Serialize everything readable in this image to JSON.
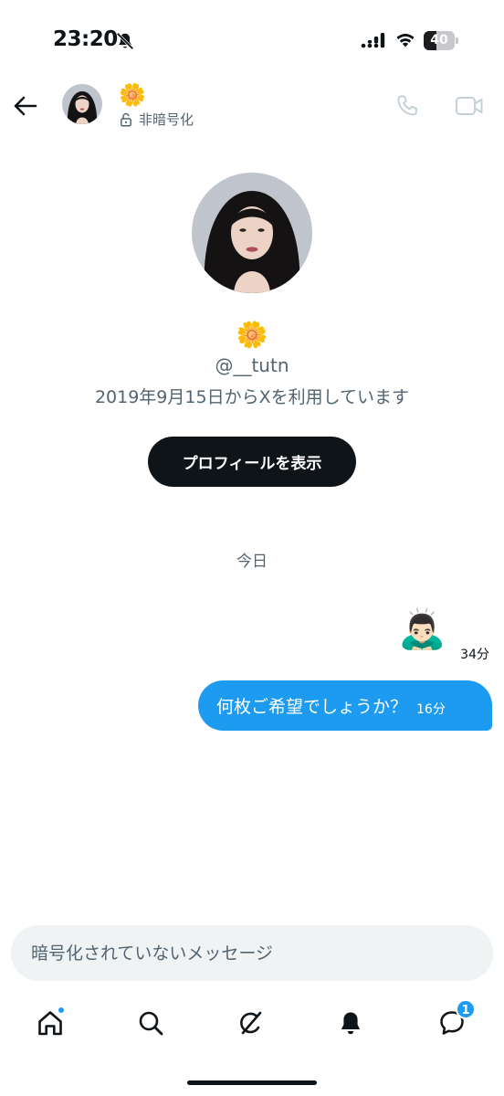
{
  "status_bar": {
    "time": "23:20",
    "battery_level": "40",
    "battery_fraction": 0.4
  },
  "header": {
    "name_emoji": "🌼",
    "encryption_status": "非暗号化"
  },
  "profile": {
    "emoji": "🌼",
    "handle": "@__tutn",
    "joined": "2019年9月15日からXを利用しています",
    "view_profile_label": "プロフィールを表示"
  },
  "chat": {
    "date_divider": "今日",
    "messages": [
      {
        "type": "emoji",
        "text": "🙇🏻‍♂️",
        "time": "34分"
      },
      {
        "type": "text",
        "text": "何枚ご希望でしょうか？",
        "time": "16分"
      }
    ]
  },
  "composer": {
    "placeholder": "暗号化されていないメッセージ"
  },
  "bottom_nav": {
    "messages_badge": "1"
  },
  "colors": {
    "accent": "#1d9bf0",
    "text_primary": "#0f1419",
    "text_secondary": "#536471",
    "composer_bg": "#eff3f4"
  },
  "icons": [
    "muted-bell-icon",
    "signal-icon",
    "wifi-icon",
    "battery-icon",
    "back-arrow-icon",
    "lock-icon",
    "phone-icon",
    "video-icon",
    "home-icon",
    "search-icon",
    "grok-icon",
    "bell-icon",
    "messages-icon"
  ]
}
